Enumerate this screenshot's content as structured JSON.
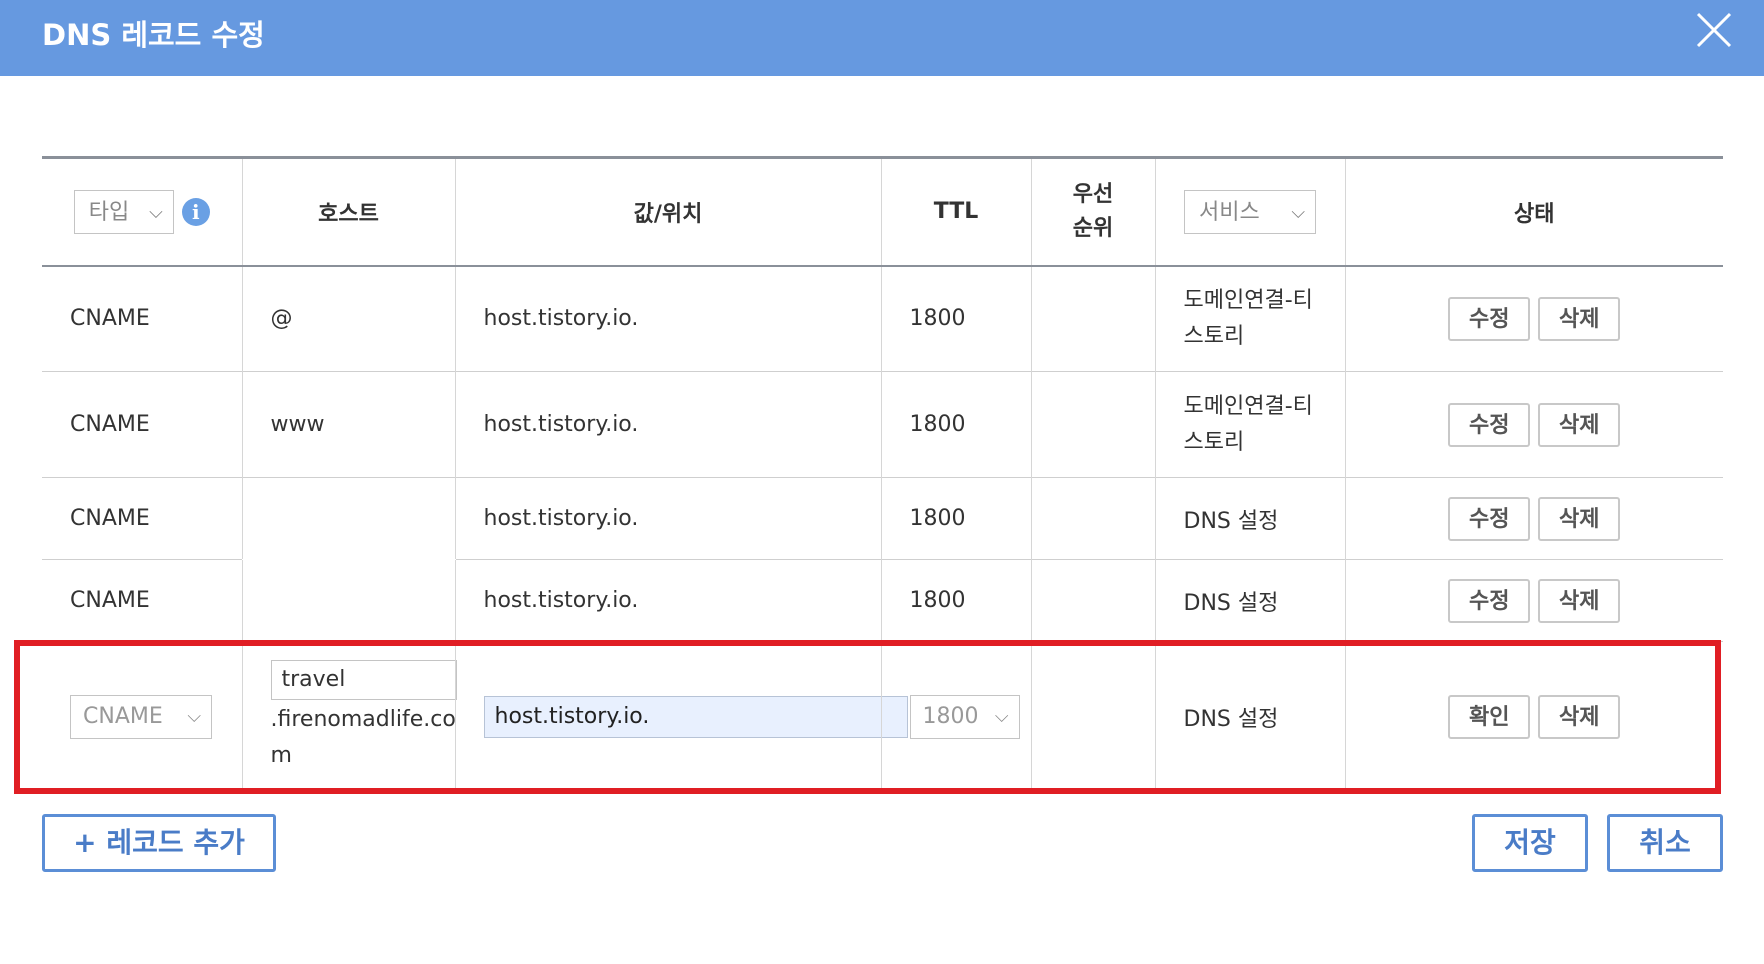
{
  "dialog": {
    "title": "DNS 레코드 수정",
    "close_icon": "close-icon"
  },
  "headers": {
    "type_select": "타입",
    "host": "호스트",
    "value": "값/위치",
    "ttl": "TTL",
    "priority_line1": "우선",
    "priority_line2": "순위",
    "service_select": "서비스",
    "status": "상태",
    "info_icon_glyph": "i"
  },
  "rows": [
    {
      "type": "CNAME",
      "host": "@",
      "value": "host.tistory.io.",
      "ttl": "1800",
      "priority": "",
      "service": "도메인연결-티스토리",
      "edit": "수정",
      "delete": "삭제"
    },
    {
      "type": "CNAME",
      "host": "www",
      "value": "host.tistory.io.",
      "ttl": "1800",
      "priority": "",
      "service": "도메인연결-티스토리",
      "edit": "수정",
      "delete": "삭제"
    },
    {
      "type": "CNAME",
      "host": "",
      "value": "host.tistory.io.",
      "ttl": "1800",
      "priority": "",
      "service": "DNS 설정",
      "edit": "수정",
      "delete": "삭제"
    },
    {
      "type": "CNAME",
      "host": "",
      "value": "host.tistory.io.",
      "ttl": "1800",
      "priority": "",
      "service": "DNS 설정",
      "edit": "수정",
      "delete": "삭제"
    }
  ],
  "edit_row": {
    "type": "CNAME",
    "host_input": "travel",
    "host_suffix": ".firenomadlife.com",
    "value_input": "host.tistory.io.",
    "ttl": "1800",
    "priority": "",
    "service": "DNS 설정",
    "confirm": "확인",
    "delete": "삭제"
  },
  "footer": {
    "add_record": "+ 레코드 추가",
    "save": "저장",
    "cancel": "취소"
  },
  "colors": {
    "header_bar": "#6699e0",
    "highlight": "#e01e24",
    "button_border": "#5b8ed6"
  }
}
